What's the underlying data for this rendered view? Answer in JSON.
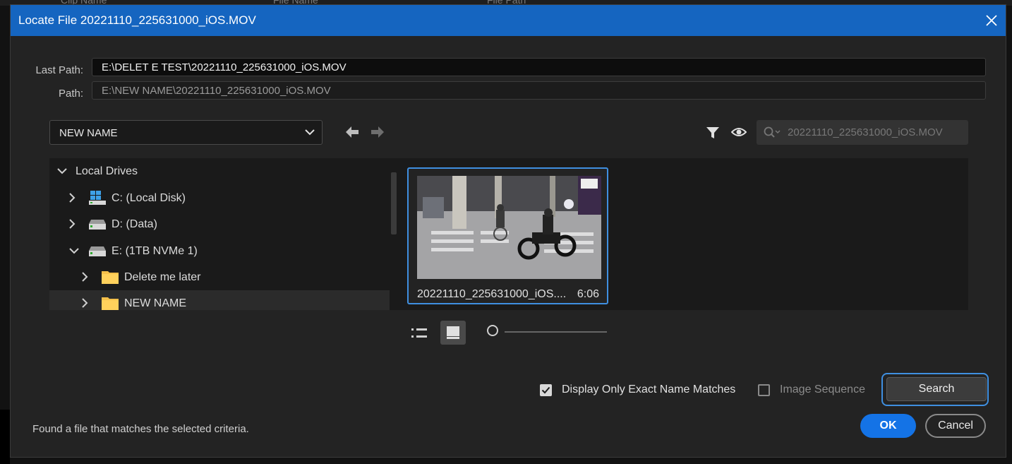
{
  "background": {
    "columns": [
      "Clip Name",
      "File Name",
      "File Path"
    ]
  },
  "dialog": {
    "title": "Locate File 20221110_225631000_iOS.MOV",
    "close_icon": "close-icon",
    "accent_color": "#1565c0"
  },
  "paths": {
    "last_path_label": "Last Path:",
    "last_path_value": "E:\\DELET E TEST\\20221110_225631000_iOS.MOV",
    "path_label": "Path:",
    "path_value": "E:\\NEW NAME\\20221110_225631000_iOS.MOV"
  },
  "toolbar": {
    "folder_dropdown_value": "NEW NAME",
    "back_icon": "arrow-left-icon",
    "forward_icon": "arrow-right-icon",
    "filter_icon": "filter-icon",
    "view_icon": "eye-icon",
    "search_placeholder": "20221110_225631000_iOS.MOV"
  },
  "tree": {
    "items": [
      {
        "label": "Local Drives",
        "icon": "chevron-down-icon"
      },
      {
        "label": "C: (Local Disk)",
        "icon": "windows-drive-icon"
      },
      {
        "label": "D: (Data)",
        "icon": "drive-icon"
      },
      {
        "label": "E: (1TB NVMe 1)",
        "icon": "drive-icon"
      },
      {
        "label": "Delete me later",
        "icon": "folder-icon"
      },
      {
        "label": "NEW NAME",
        "icon": "folder-icon"
      }
    ]
  },
  "files": [
    {
      "name": "20221110_225631000_iOS....",
      "duration": "6:06"
    }
  ],
  "view_controls": {
    "list_view_icon": "list-view-icon",
    "icon_view_icon": "icon-view-icon",
    "zoom_level": 0
  },
  "options": {
    "exact_match_label": "Display Only Exact Name Matches",
    "exact_match_checked": true,
    "image_sequence_label": "Image Sequence",
    "image_sequence_checked": false
  },
  "buttons": {
    "search": "Search",
    "ok": "OK",
    "cancel": "Cancel"
  },
  "status": "Found a file that matches the selected criteria."
}
